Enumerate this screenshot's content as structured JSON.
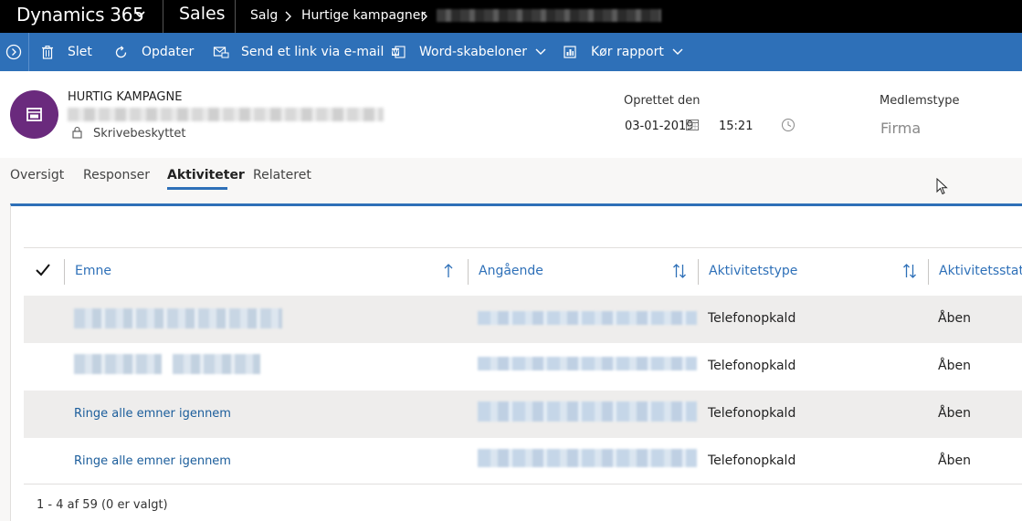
{
  "topbar": {
    "app_name": "Dynamics 365",
    "module": "Sales",
    "breadcrumb": [
      "Salg",
      "Hurtige kampagner"
    ]
  },
  "commands": [
    {
      "label": "Slet",
      "icon": "trash-icon"
    },
    {
      "label": "Opdater",
      "icon": "refresh-icon"
    },
    {
      "label": "Send et link via e-mail",
      "icon": "email-link-icon"
    },
    {
      "label": "Word-skabeloner",
      "icon": "word-icon"
    },
    {
      "label": "Kør rapport",
      "icon": "report-icon"
    }
  ],
  "header": {
    "record_type": "HURTIG KAMPAGNE",
    "readonly": "Skrivebeskyttet",
    "created_label": "Oprettet den",
    "created_date": "03-01-2019",
    "created_time": "15:21",
    "member_type_label": "Medlemstype",
    "member_type_value": "Firma"
  },
  "tabs": [
    {
      "label": "Oversigt",
      "active": false
    },
    {
      "label": "Responser",
      "active": false
    },
    {
      "label": "Aktiviteter",
      "active": true
    },
    {
      "label": "Relateret",
      "active": false
    }
  ],
  "grid": {
    "columns": [
      "Emne",
      "Angående",
      "Aktivitetstype",
      "Aktivitetsstatu"
    ],
    "rows": [
      {
        "subject": "",
        "type": "Telefonopkald",
        "status": "Åben"
      },
      {
        "subject": "",
        "type": "Telefonopkald",
        "status": "Åben"
      },
      {
        "subject": "Ringe alle emner igennem",
        "type": "Telefonopkald",
        "status": "Åben"
      },
      {
        "subject": "Ringe alle emner igennem",
        "type": "Telefonopkald",
        "status": "Åben"
      }
    ],
    "status_text": "1 - 4 af 59 (0 er valgt)"
  },
  "colors": {
    "topbar": "#000000",
    "command_bar": "#2e70b8",
    "avatar": "#6a2a7d",
    "link": "#1b5d9b"
  }
}
